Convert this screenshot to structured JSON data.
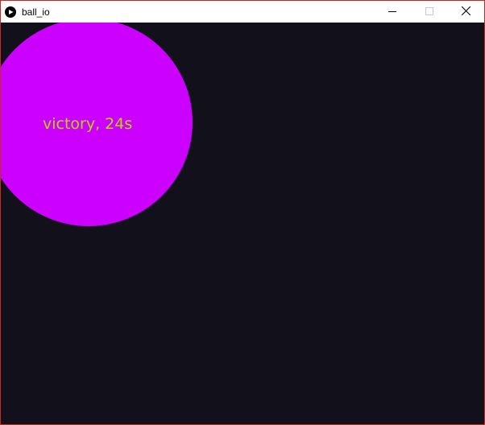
{
  "window": {
    "title": "ball_io"
  },
  "game": {
    "status_text": "victory, 24s"
  },
  "colors": {
    "background": "#12101a",
    "ball": "#cc00ff",
    "status_text": "#b8d40a",
    "window_border": "#c42b1c"
  },
  "icons": {
    "app": "play-circle-icon",
    "minimize": "minimize-icon",
    "maximize": "maximize-icon",
    "close": "close-icon"
  }
}
